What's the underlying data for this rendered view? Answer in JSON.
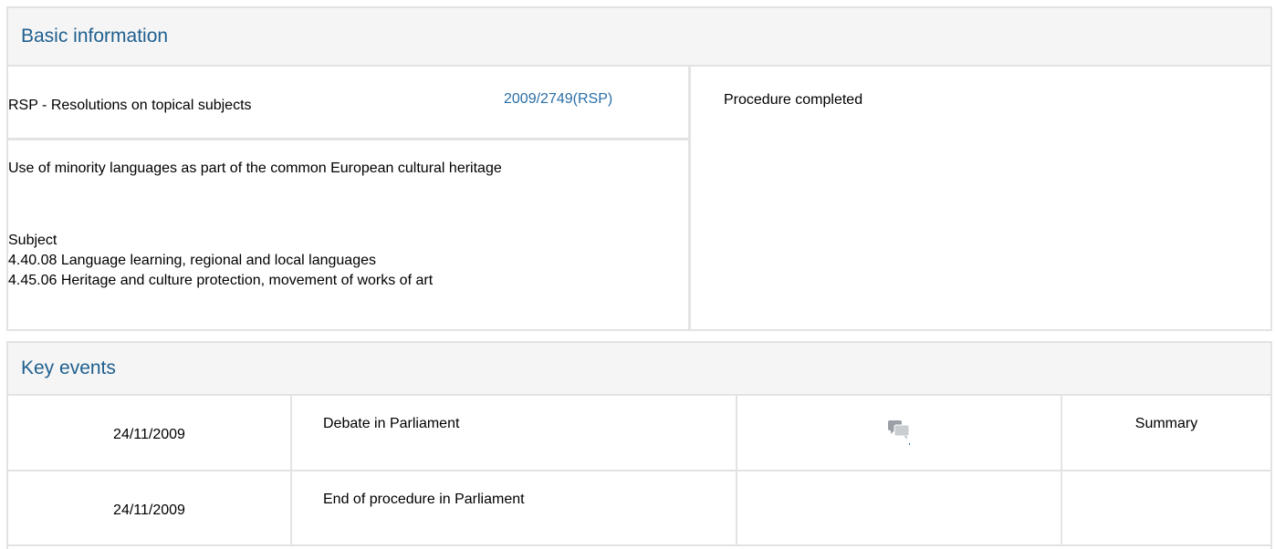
{
  "basic_information": {
    "heading": "Basic information",
    "procedure_type": "RSP - Resolutions on topical subjects",
    "procedure_reference": "2009/2749(RSP)",
    "status": "Procedure completed",
    "title": "Use of minority languages as part of the common European cultural heritage",
    "subject_label": "Subject",
    "subjects": [
      "4.40.08 Language learning, regional and local languages",
      "4.45.06 Heritage and culture protection, movement of works of art"
    ]
  },
  "key_events": {
    "heading": "Key events",
    "rows": [
      {
        "date": "24/11/2009",
        "event": "Debate in Parliament",
        "icon": "debate-speech-icon",
        "summary": "Summary"
      },
      {
        "date": "24/11/2009",
        "event": "End of procedure in Parliament",
        "icon": "",
        "summary": ""
      }
    ]
  },
  "colors": {
    "heading_text": "#1f5f8f",
    "link": "#2a6ea6",
    "border": "#e3e3e3",
    "header_bg": "#f5f5f5"
  }
}
